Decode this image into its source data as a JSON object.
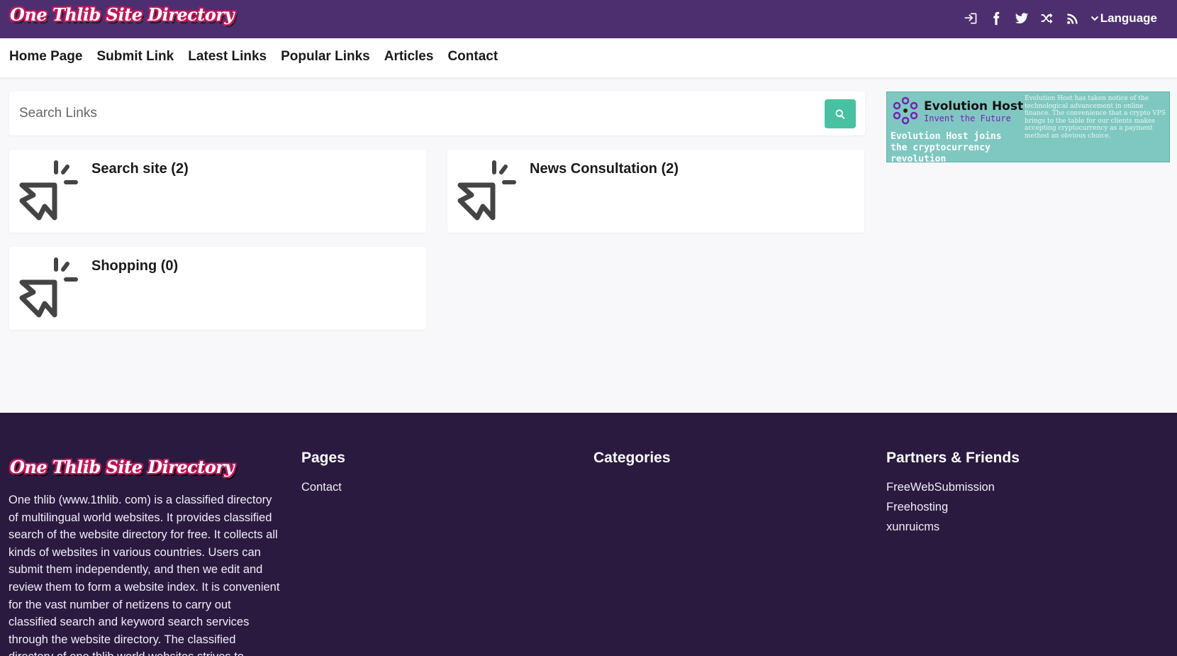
{
  "site": {
    "logo_text": "One Thlib Site Directory"
  },
  "topbar": {
    "icons": [
      "sign-in-icon",
      "facebook-icon",
      "twitter-icon",
      "random-icon",
      "rss-icon"
    ],
    "language_label": "Language"
  },
  "nav": {
    "items": [
      "Home Page",
      "Submit Link",
      "Latest Links",
      "Popular Links",
      "Articles",
      "Contact"
    ]
  },
  "search": {
    "placeholder": "Search Links"
  },
  "categories": [
    {
      "title": "Search site (2)"
    },
    {
      "title": "News Consultation (2)"
    },
    {
      "title": "Shopping (0)"
    }
  ],
  "ad": {
    "brand": "Evolution Host",
    "tagline": "Invent the Future",
    "headline": "Evolution Host joins the cryptocurrency revolution",
    "body": "Evolution Host has taken notice of the technological advancement in online finance. The convenience that a crypto VPS brings to the table for our clients makes accepting cryptocurrency as a payment method an obvious choice."
  },
  "footer": {
    "logo_text": "One Thlib Site Directory",
    "about": "One thlib (www.1thlib. com) is a classified directory of multilingual world websites. It provides classified search of the website directory for free. It collects all kinds of websites in various countries. Users can submit them independently, and then we edit and review them to form a website index. It is convenient for the vast number of netizens to carry out classified search and keyword search services through the website directory. The classified directory of one thlib world websites strives to",
    "pages_title": "Pages",
    "pages": [
      "Contact"
    ],
    "categories_title": "Categories",
    "partners_title": "Partners & Friends",
    "partners": [
      "FreeWebSubmission",
      "Freehosting",
      "xunruicms"
    ]
  },
  "colors": {
    "topbar": "#4d2f70",
    "footer": "#2a1a40",
    "search_button": "#48c1a0",
    "ad_background": "#7fc8c1"
  }
}
